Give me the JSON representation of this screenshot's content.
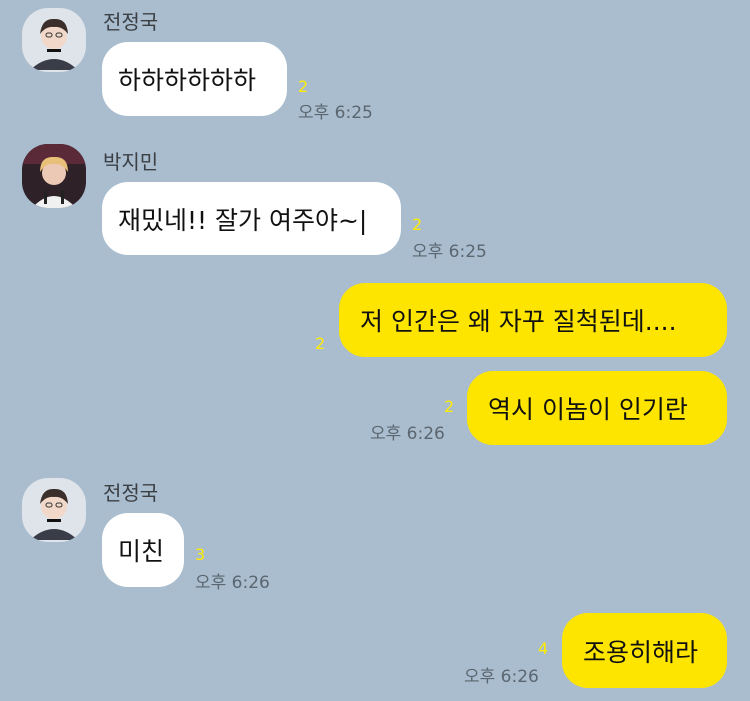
{
  "messages": [
    {
      "sender": "전정국",
      "text": "하하하하하하",
      "unread": "2",
      "time": "오후 6:25"
    },
    {
      "sender": "박지민",
      "text": "재밌네!! 잘가 여주야~|",
      "unread": "2",
      "time": "오후 6:25"
    },
    {
      "sender": "",
      "text": "저 인간은 왜 자꾸 질척된데....",
      "unread": "2",
      "time": ""
    },
    {
      "sender": "",
      "text": "역시 이놈이 인기란",
      "unread": "2",
      "time": "오후 6:26"
    },
    {
      "sender": "전정국",
      "text": "미친",
      "unread": "3",
      "time": "오후 6:26"
    },
    {
      "sender": "",
      "text": "조용히해라",
      "unread": "4",
      "time": "오후 6:26"
    }
  ],
  "colors": {
    "background": "#a9bdce",
    "incoming_bubble": "#ffffff",
    "outgoing_bubble": "#fee500",
    "unread_count": "#fdeb00"
  },
  "avatars": [
    "jeongguk-profile-photo",
    "jimin-profile-photo",
    "jeongguk-profile-photo"
  ]
}
